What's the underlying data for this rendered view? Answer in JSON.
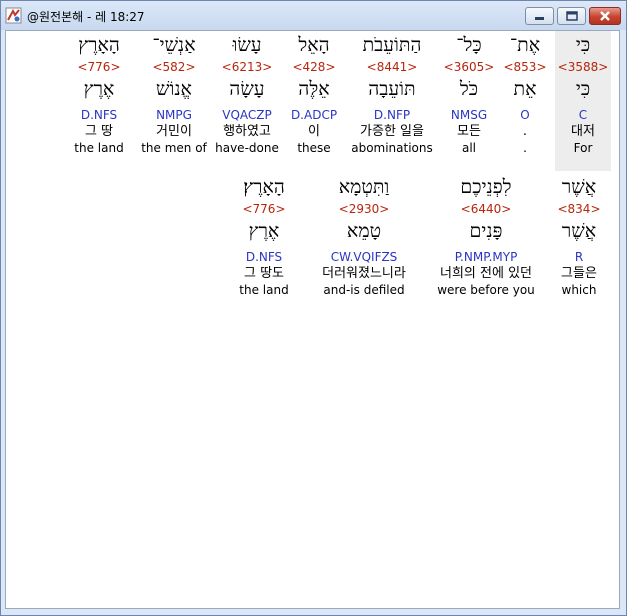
{
  "window": {
    "title": "@원전본해 - 레 18:27",
    "close_color": "#c5442f",
    "strong_color": "#b8250c",
    "parse_color": "#2a35c4"
  },
  "line1": [
    {
      "heb": "כִּי",
      "strong": "<3588>",
      "lex": "כִּי",
      "parse": "C",
      "kor": "대저",
      "eng": "For"
    },
    {
      "heb": "אֶת־",
      "strong": "<853>",
      "lex": "אֵת",
      "parse": "O",
      "kor": ".",
      "eng": "."
    },
    {
      "heb": "כָּל־",
      "strong": "<3605>",
      "lex": "כֹּל",
      "parse": "NMSG",
      "kor": "모든",
      "eng": "all"
    },
    {
      "heb": "הַתּוֹעֵבֹת",
      "strong": "<8441>",
      "lex": "תּוֹעֵבָה",
      "parse": "D.NFP",
      "kor": "가증한 일을",
      "eng": "abominations"
    },
    {
      "heb": "הָאֵל",
      "strong": "<428>",
      "lex": "אֵלֶּה",
      "parse": "D.ADCP",
      "kor": "이",
      "eng": "these"
    },
    {
      "heb": "עָשׂוּ",
      "strong": "<6213>",
      "lex": "עָשָׂה",
      "parse": "VQACZP",
      "kor": "행하였고",
      "eng": "have-done"
    },
    {
      "heb": "אַנְשֵׁי־",
      "strong": "<582>",
      "lex": "אֱנוֹשׁ",
      "parse": "NMPG",
      "kor": "거민이",
      "eng": "the men of"
    },
    {
      "heb": "הָאָרֶץ",
      "strong": "<776>",
      "lex": "אֶרֶץ",
      "parse": "D.NFS",
      "kor": "그 땅",
      "eng": "the land"
    }
  ],
  "line2": [
    {
      "heb": "אֲשֶׁר",
      "strong": "<834>",
      "lex": "אֲשֶׁר",
      "parse": "R",
      "kor": "그들은",
      "eng": "which"
    },
    {
      "heb": "לִפְנֵיכֶם",
      "strong": "<6440>",
      "lex": "פָּנִים",
      "parse": "P.NMP.MYP",
      "kor": "너희의 전에 있던",
      "eng": "were before you"
    },
    {
      "heb": "וַתִּטְמָא",
      "strong": "<2930>",
      "lex": "טָמֵא",
      "parse": "CW.VQIFZS",
      "kor": "더러워졌느니라",
      "eng": "and-is defiled"
    },
    {
      "heb": "הָאָרֶץ׃",
      "strong": "<776>",
      "lex": "אֶרֶץ",
      "parse": "D.NFS",
      "kor": "그 땅도",
      "eng": "the land"
    }
  ]
}
